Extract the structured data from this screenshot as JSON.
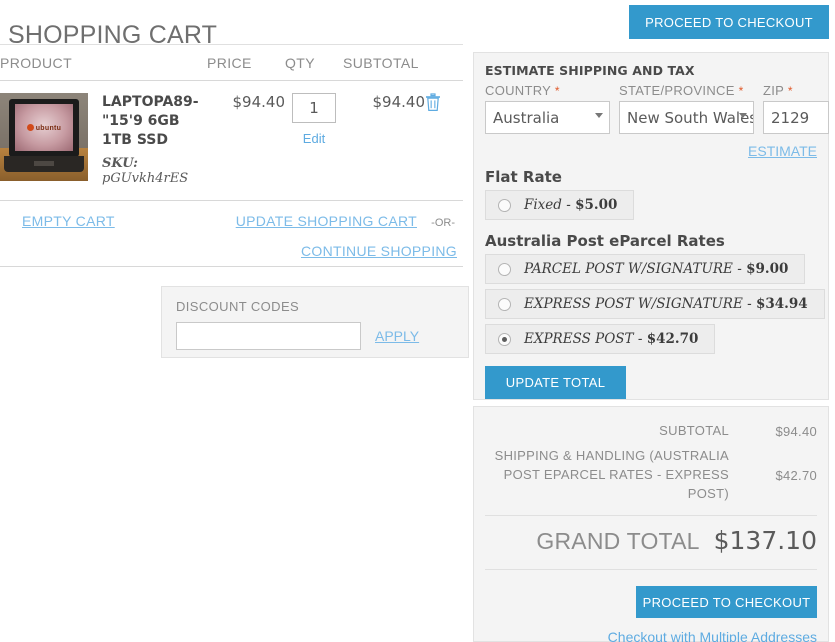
{
  "page": {
    "title": "SHOPPING CART"
  },
  "top_actions": {
    "proceed_checkout": "PROCEED TO CHECKOUT"
  },
  "cart_table": {
    "columns": {
      "product": "PRODUCT",
      "price": "PRICE",
      "qty": "QTY",
      "subtotal": "SUBTOTAL"
    },
    "rows": [
      {
        "image": "laptop-ubuntu-thumbnail",
        "image_logo_text": "ubuntu",
        "name": "LAPTOPA89-\"15'9 6GB 1TB SSD",
        "sku_label": "SKU:",
        "sku_value": "pGUvkh4rES",
        "price": "$94.40",
        "qty": "1",
        "edit_label": "Edit",
        "subtotal": "$94.40",
        "remove_icon": "trash-icon"
      }
    ]
  },
  "cart_actions": {
    "empty_cart": "EMPTY CART",
    "update_cart": "UPDATE SHOPPING CART",
    "or_separator": "-OR-",
    "continue_shopping": "CONTINUE SHOPPING"
  },
  "discount": {
    "title": "DISCOUNT CODES",
    "input_value": "",
    "placeholder": "",
    "apply_label": "APPLY"
  },
  "shipping": {
    "heading": "ESTIMATE SHIPPING AND TAX",
    "country": {
      "label": "COUNTRY",
      "required_mark": "*",
      "value": "Australia"
    },
    "state": {
      "label": "STATE/PROVINCE",
      "required_mark": "*",
      "value": "New South Wales"
    },
    "zip": {
      "label": "ZIP",
      "required_mark": "*",
      "value": "2129"
    },
    "estimate_link": "ESTIMATE",
    "groups": [
      {
        "title": "Flat Rate",
        "options": [
          {
            "name": "Fixed",
            "dash": " - ",
            "price": "$5.00",
            "selected": false
          }
        ]
      },
      {
        "title": "Australia Post eParcel Rates",
        "options": [
          {
            "name": "PARCEL POST W/SIGNATURE",
            "dash": " - ",
            "price": "$9.00",
            "selected": false
          },
          {
            "name": "EXPRESS POST W/SIGNATURE",
            "dash": " - ",
            "price": "$34.94",
            "selected": false
          },
          {
            "name": "EXPRESS POST",
            "dash": " - ",
            "price": "$42.70",
            "selected": true
          }
        ]
      }
    ],
    "update_total_label": "UPDATE TOTAL"
  },
  "totals": {
    "rows": [
      {
        "label": "SUBTOTAL",
        "value": "$94.40"
      },
      {
        "label": "SHIPPING & HANDLING (AUSTRALIA POST EPARCEL RATES - EXPRESS POST)",
        "value": "$42.70"
      }
    ],
    "grand_total_label": "GRAND TOTAL",
    "grand_total_value": "$137.10",
    "proceed_checkout": "PROCEED TO CHECKOUT",
    "multiple_addresses": "Checkout with Multiple Addresses"
  },
  "colors": {
    "accent_blue": "#3399cc",
    "link_blue": "#7cbbe8",
    "panel_bg": "#f4f4f4",
    "required_red": "#e05a2b"
  }
}
